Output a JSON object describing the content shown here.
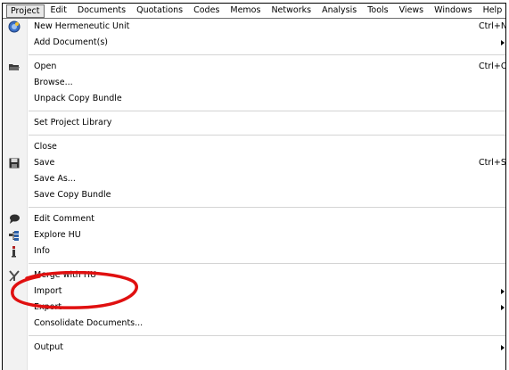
{
  "menubar": {
    "items": [
      {
        "label": "Project"
      },
      {
        "label": "Edit"
      },
      {
        "label": "Documents"
      },
      {
        "label": "Quotations"
      },
      {
        "label": "Codes"
      },
      {
        "label": "Memos"
      },
      {
        "label": "Networks"
      },
      {
        "label": "Analysis"
      },
      {
        "label": "Tools"
      },
      {
        "label": "Views"
      },
      {
        "label": "Windows"
      },
      {
        "label": "Help"
      }
    ]
  },
  "menu": {
    "new_hu": {
      "label": "New Hermeneutic Unit",
      "shortcut": "Ctrl+N",
      "icon": "new-unit-icon"
    },
    "add_docs": {
      "label": "Add Document(s)"
    },
    "open": {
      "label": "Open",
      "shortcut": "Ctrl+O",
      "icon": "open-folder-icon"
    },
    "browse": {
      "label": "Browse..."
    },
    "unpack": {
      "label": "Unpack Copy Bundle"
    },
    "set_library": {
      "label": "Set Project Library"
    },
    "close": {
      "label": "Close"
    },
    "save": {
      "label": "Save",
      "shortcut": "Ctrl+S",
      "icon": "floppy-disk-icon"
    },
    "save_as": {
      "label": "Save As..."
    },
    "save_bundle": {
      "label": "Save Copy Bundle"
    },
    "edit_comment": {
      "label": "Edit Comment",
      "icon": "speech-bubble-icon"
    },
    "explore": {
      "label": "Explore HU",
      "icon": "tree-explorer-icon"
    },
    "info": {
      "label": "Info",
      "icon": "info-icon"
    },
    "merge": {
      "label": "Merge with HU",
      "icon": "merge-icon"
    },
    "import": {
      "label": "Import"
    },
    "export": {
      "label": "Export"
    },
    "consolidate": {
      "label": "Consolidate Documents..."
    },
    "output": {
      "label": "Output"
    }
  },
  "annotation": {
    "color": "#e01010"
  }
}
